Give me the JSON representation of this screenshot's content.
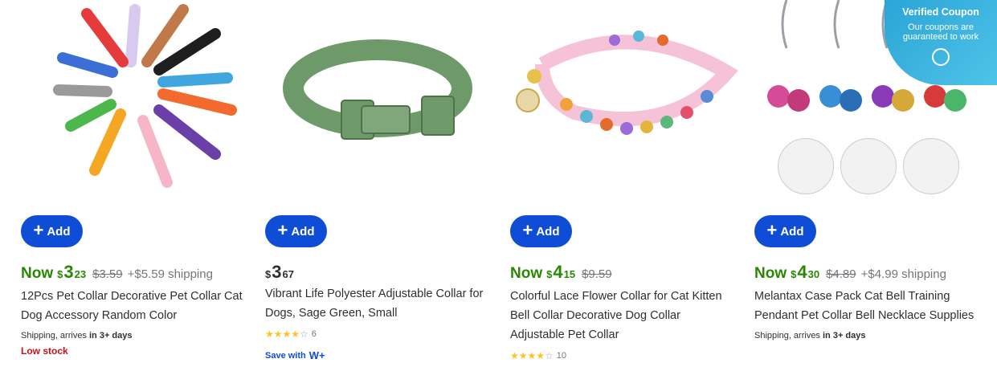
{
  "products": [
    {
      "add_label": "Add",
      "now_label": "Now",
      "price_dollar": "$",
      "price_whole": "3",
      "price_cents": "23",
      "was_price": "$3.59",
      "shipping": "+$5.59 shipping",
      "title": "12Pcs Pet Collar Decorative Pet Collar Cat Dog Accessory Random Color",
      "shipping_info_prefix": "Shipping, arrives",
      "shipping_info_bold": "in 3+ days",
      "stock_status": "Low stock",
      "image_icon": "rainbow-paw-collars-image"
    },
    {
      "add_label": "Add",
      "price_dollar": "$",
      "price_whole": "3",
      "price_cents": "67",
      "title": "Vibrant Life Polyester Adjustable Collar for Dogs, Sage Green, Small",
      "rating_stars": 4,
      "review_count": "6",
      "save_with_label": "Save with",
      "save_with_brand": "W+",
      "image_icon": "green-collar-image"
    },
    {
      "add_label": "Add",
      "now_label": "Now",
      "price_dollar": "$",
      "price_whole": "4",
      "price_cents": "15",
      "was_price": "$9.59",
      "title": "Colorful Lace Flower Collar for Cat Kitten Bell Collar Decorative Dog Collar Adjustable Pet Collar",
      "rating_stars": 4,
      "review_count": "10",
      "image_icon": "flower-collar-image"
    },
    {
      "add_label": "Add",
      "now_label": "Now",
      "price_dollar": "$",
      "price_whole": "4",
      "price_cents": "30",
      "was_price": "$4.89",
      "shipping": "+$4.99 shipping",
      "title": "Melantax Case Pack Cat Bell Training Pendant Pet Collar Bell Necklace Supplies",
      "shipping_info_prefix": "Shipping, arrives",
      "shipping_info_bold": "in 3+ days",
      "image_icon": "bell-keychains-image",
      "coupon": {
        "title": "Verified Coupon",
        "subtitle": "Our coupons are guaranteed to work"
      }
    }
  ],
  "colors": {
    "add_button": "#0f4dd6",
    "now_green": "#2a8703",
    "low_stock": "#c7101a",
    "star": "#ffc220"
  }
}
